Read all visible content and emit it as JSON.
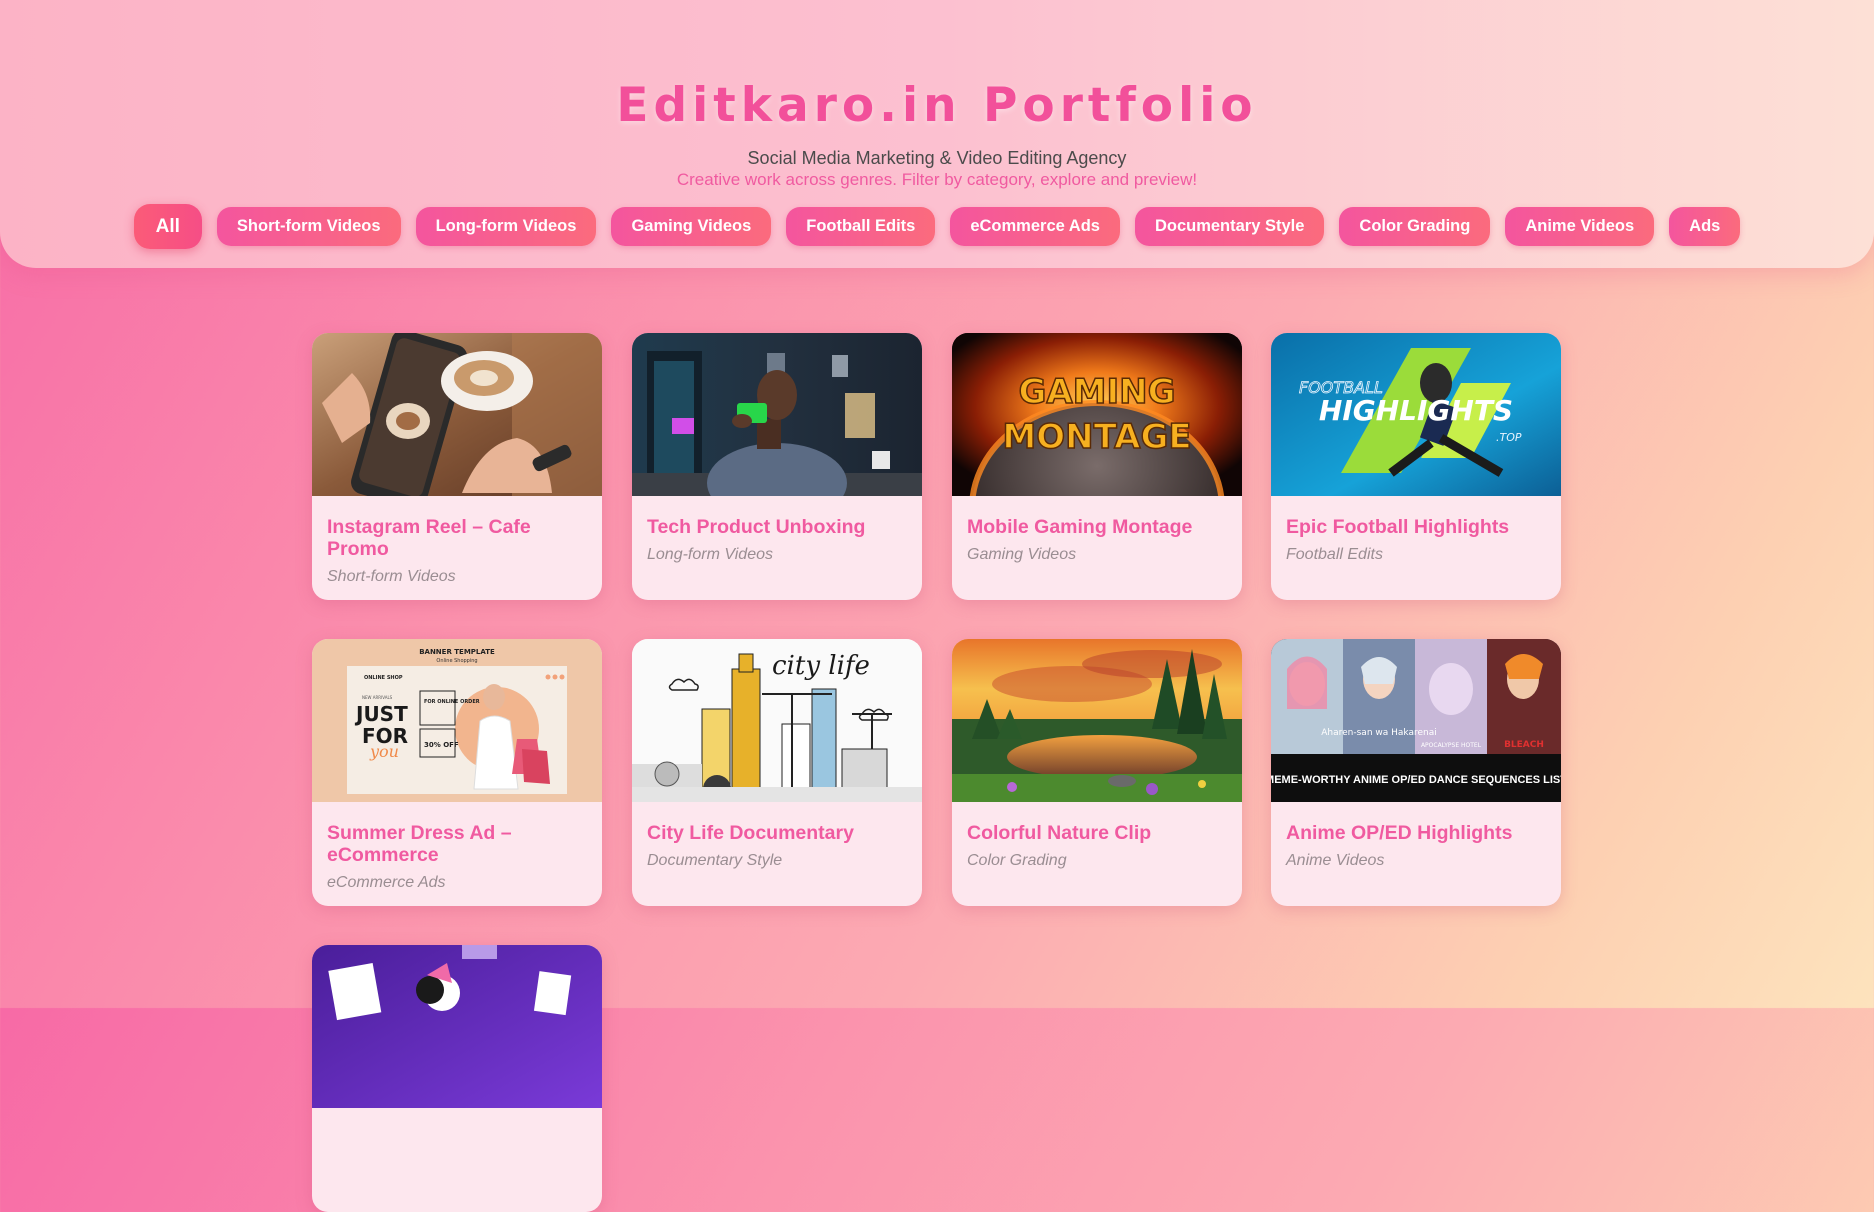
{
  "header": {
    "title": "Editkaro.in Portfolio",
    "subtitle": "Social Media Marketing & Video Editing Agency",
    "tagline": "Creative work across genres. Filter by category, explore and preview!"
  },
  "filters": [
    {
      "label": "All",
      "active": true
    },
    {
      "label": "Short-form Videos",
      "active": false
    },
    {
      "label": "Long-form Videos",
      "active": false
    },
    {
      "label": "Gaming Videos",
      "active": false
    },
    {
      "label": "Football Edits",
      "active": false
    },
    {
      "label": "eCommerce Ads",
      "active": false
    },
    {
      "label": "Documentary Style",
      "active": false
    },
    {
      "label": "Color Grading",
      "active": false
    },
    {
      "label": "Anime Videos",
      "active": false
    },
    {
      "label": "Ads",
      "active": false
    }
  ],
  "cards": [
    {
      "title": "Instagram Reel – Cafe Promo",
      "category": "Short-form Videos"
    },
    {
      "title": "Tech Product Unboxing",
      "category": "Long-form Videos"
    },
    {
      "title": "Mobile Gaming Montage",
      "category": "Gaming Videos",
      "thumb_text": [
        "GAMING",
        "MONTAGE"
      ]
    },
    {
      "title": "Epic Football Highlights",
      "category": "Football Edits",
      "thumb_text": [
        "FOOTBALL",
        "HIGHLIGHTS",
        ".TOP"
      ]
    },
    {
      "title": "Summer Dress Ad – eCommerce",
      "category": "eCommerce Ads",
      "thumb_text": [
        "BANNER TEMPLATE",
        "Online Shopping",
        "ONLINE SHOP",
        "NEW ARRIVALS",
        "JUST",
        "FOR",
        "you",
        "FOR ONLINE ORDER",
        "30% OFF"
      ]
    },
    {
      "title": "City Life Documentary",
      "category": "Documentary Style",
      "thumb_text": [
        "city life"
      ]
    },
    {
      "title": "Colorful Nature Clip",
      "category": "Color Grading"
    },
    {
      "title": "Anime OP/ED Highlights",
      "category": "Anime Videos",
      "thumb_text": [
        "MEME-WORTHY ANIME OP/ED DANCE SEQUENCES LIST",
        "Aharen-san wa Hakarenai",
        "APOCALYPSE HOTEL",
        "BLEACH"
      ]
    }
  ],
  "colors": {
    "accent": "#f05aa0",
    "title": "#f2509a",
    "button_start": "#f4559e",
    "button_end": "#fb6b7d"
  }
}
